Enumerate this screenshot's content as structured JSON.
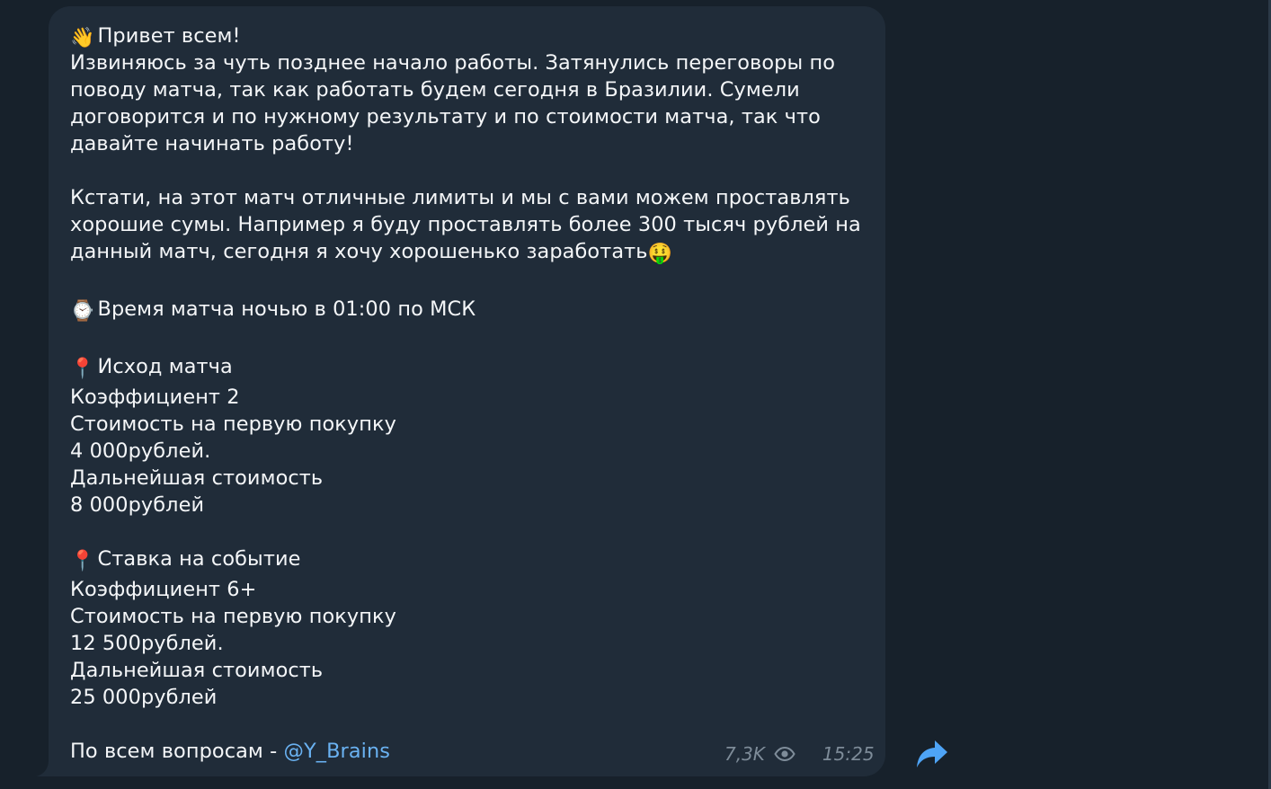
{
  "message": {
    "greeting_emoji": "👋",
    "greeting": "Привет всем!",
    "para1_lines": [
      "Извиняюсь за чуть позднее начало работы. Затянулись переговоры по",
      "поводу матча, так как работать будем сегодня в Бразилии. Сумели",
      "договорится и по нужному результату и по стоимости матча, так что",
      "давайте начинать работу!"
    ],
    "para2_lines": [
      "Кстати, на этот матч отличные лимиты и мы с вами можем проставлять",
      "хорошие сумы. Например я буду проставлять более 300 тысяч рублей на",
      "данный матч, сегодня я хочу хорошенько заработать"
    ],
    "money_emoji": "🤑",
    "time_emoji": "⌚",
    "time_text": "Время матча ночью в 01:00 по МСК",
    "pin_emoji": "📍",
    "section1": {
      "title": "Исход матча",
      "lines": [
        "Коэффициент 2",
        "Стоимость на первую покупку",
        "4 000рублей.",
        "Дальнейшая стоимость",
        "8 000рублей"
      ]
    },
    "section2": {
      "title": "Ставка на событие",
      "lines": [
        "Коэффициент 6+",
        "Стоимость на первую покупку",
        "12 500рублей.",
        "Дальнейшая стоимость",
        "25 000рублей"
      ]
    },
    "contact_prefix": "По всем вопросам - ",
    "contact_link": "@Y_Brains"
  },
  "meta": {
    "views": "7,3K",
    "time": "15:25"
  },
  "icons": {
    "views": "eye-icon",
    "share": "share-arrow-icon"
  },
  "colors": {
    "background": "#17212b",
    "bubble": "#202c39",
    "text": "#f4f6f8",
    "link": "#6ab2f2",
    "meta": "#7e8c99",
    "share": "#4ea4f6"
  }
}
